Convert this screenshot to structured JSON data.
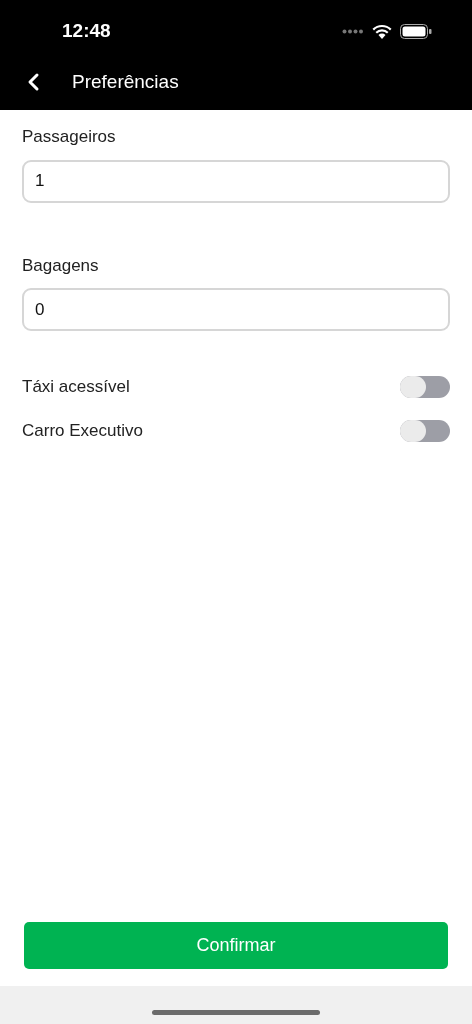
{
  "status_bar": {
    "time": "12:48"
  },
  "header": {
    "title": "Preferências"
  },
  "fields": [
    {
      "label": "Passageiros",
      "value": "1"
    },
    {
      "label": "Bagagens",
      "value": "0"
    }
  ],
  "toggles": [
    {
      "label": "Táxi acessível",
      "on": false
    },
    {
      "label": "Carro Executivo",
      "on": false
    }
  ],
  "confirm_button": "Confirmar"
}
